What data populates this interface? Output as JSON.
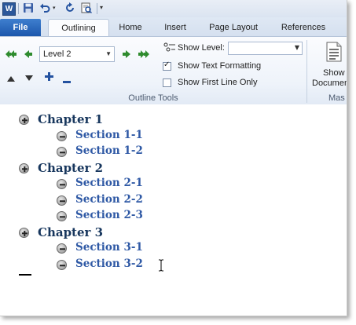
{
  "quick_access": {
    "app_icon_letter": "W",
    "items": [
      "save-icon",
      "undo-icon",
      "redo-icon",
      "print-preview-icon",
      "customize-icon"
    ]
  },
  "tabs": {
    "file": "File",
    "items": [
      "Outlining",
      "Home",
      "Insert",
      "Page Layout",
      "References"
    ],
    "active": "Outlining"
  },
  "ribbon": {
    "outline_level_value": "Level 2",
    "show_level_label": "Show Level:",
    "show_level_value": "",
    "show_text_formatting_label": "Show Text Formatting",
    "show_text_formatting_checked": true,
    "show_first_line_only_label": "Show First Line Only",
    "show_first_line_only_checked": false,
    "group_label": "Outline Tools",
    "show_document_label_1": "Show",
    "show_document_label_2": "Documen",
    "master_group_label": "Mas"
  },
  "outline": [
    {
      "level": 1,
      "text": "Chapter 1",
      "symbol": "plus"
    },
    {
      "level": 2,
      "text": "Section 1-1",
      "symbol": "minus"
    },
    {
      "level": 2,
      "text": "Section 1-2",
      "symbol": "minus"
    },
    {
      "level": 1,
      "text": "Chapter 2",
      "symbol": "plus"
    },
    {
      "level": 2,
      "text": "Section 2-1",
      "symbol": "minus"
    },
    {
      "level": 2,
      "text": "Section 2-2",
      "symbol": "minus"
    },
    {
      "level": 2,
      "text": "Section 2-3",
      "symbol": "minus"
    },
    {
      "level": 1,
      "text": "Chapter 3",
      "symbol": "plus"
    },
    {
      "level": 2,
      "text": "Section 3-1",
      "symbol": "minus"
    },
    {
      "level": 2,
      "text": "Section 3-2",
      "symbol": "minus"
    }
  ],
  "colors": {
    "file_tab": "#2b6ac0",
    "heading1": "#17365d",
    "heading2": "#2f59a5"
  }
}
